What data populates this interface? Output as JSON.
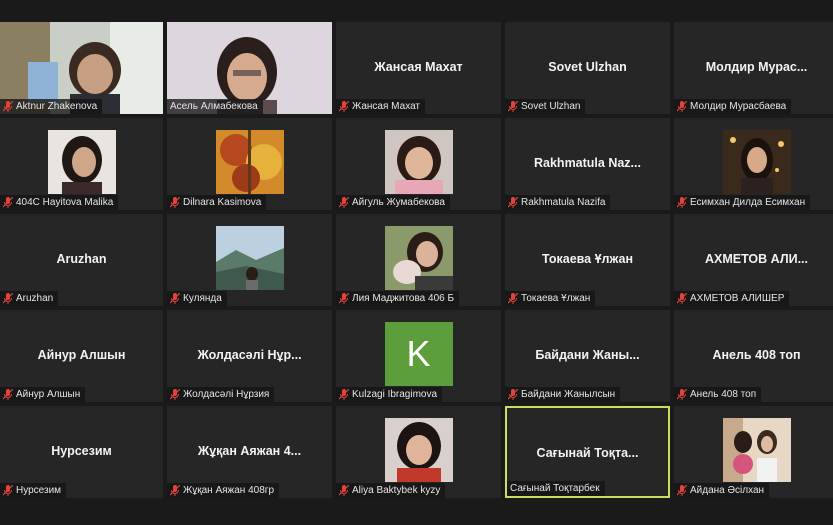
{
  "participants": [
    {
      "label": "Aktnur Zhakenova",
      "photo": "video-photo-1"
    },
    {
      "label": "Асель Алмабекова",
      "photo": "video-photo-2"
    },
    {
      "label": "Жансая Махат",
      "name": "Жансая Махат"
    },
    {
      "label": "Sovet Ulzhan",
      "name": "Sovet Ulzhan"
    },
    {
      "label": "Молдир Мурасбаева",
      "name": "Молдир Мурас..."
    },
    {
      "label": "404C Hayitova Malika",
      "photo": "profile-photo"
    },
    {
      "label": "Dilnara Kasimova",
      "photo": "profile-photo"
    },
    {
      "label": "Айгуль Жумабекова",
      "photo": "profile-photo"
    },
    {
      "label": "Rakhmatula Nazifa",
      "name": "Rakhmatula Naz..."
    },
    {
      "label": "Есимхан Дилда Есимхан",
      "photo": "profile-photo"
    },
    {
      "label": "Aruzhan",
      "name": "Aruzhan"
    },
    {
      "label": "Кулянда",
      "photo": "profile-photo"
    },
    {
      "label": "Лия Маджитова 406 Б",
      "photo": "profile-photo"
    },
    {
      "label": "Токаева Ұлжан",
      "name": "Токаева Ұлжан"
    },
    {
      "label": "АХМЕТОВ АЛИШЕР",
      "name": "АХМЕТОВ АЛИ..."
    },
    {
      "label": "Айнур Алшын",
      "name": "Айнур Алшын"
    },
    {
      "label": "Жолдасәлі Нұрзия",
      "name": "Жолдасәлі Нұр..."
    },
    {
      "label": "Kulzagi Ibragimova",
      "avatar_letter": "K"
    },
    {
      "label": "Байдани Жанылсын",
      "name": "Байдани Жаны..."
    },
    {
      "label": "Анель 408 топ",
      "name": "Анель 408 топ"
    },
    {
      "label": "Нурсезим",
      "name": "Нурсезим"
    },
    {
      "label": "Жұқан Аяжан 408гр",
      "name": "Жұқан Аяжан 4..."
    },
    {
      "label": "Aliya Baktybek kyzy",
      "photo": "profile-photo"
    },
    {
      "label": "Сағынай Тоқтарбек",
      "name": "Сағынай Тоқта...",
      "active": true
    },
    {
      "label": "Айдана Әсілхан",
      "photo": "profile-photo"
    }
  ],
  "colors": {
    "background": "#1a1a1a",
    "tile": "#262626",
    "active_border": "#c8e05a",
    "mic_muted": "#e0433b",
    "avatar_k": "#5c9e3c"
  },
  "icons": {
    "muted_mic": "muted-mic-icon"
  }
}
